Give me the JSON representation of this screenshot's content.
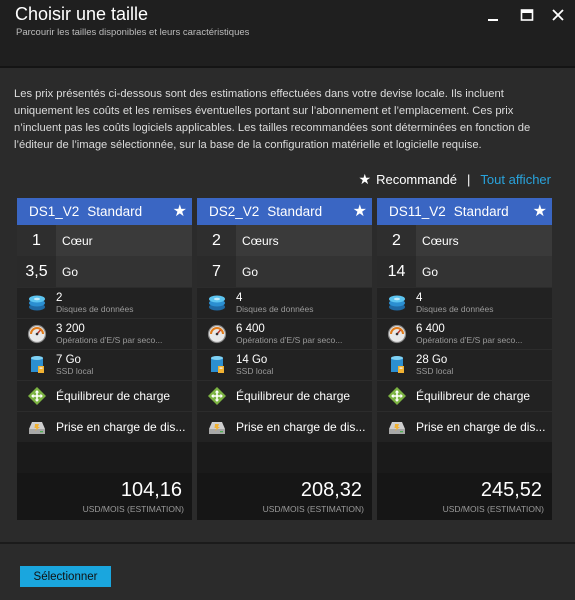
{
  "header": {
    "title": "Choisir une taille",
    "subtitle": "Parcourir les tailles disponibles et leurs caractéristiques"
  },
  "description": "Les prix présentés ci-dessous sont des estimations effectuées dans votre devise locale. Ils incluent uniquement les coûts et les remises éventuelles portant sur l’abonnement et l’emplacement. Ces prix n’incluent pas les coûts logiciels applicables. Les tailles recommandées sont déterminées en fonction de l’éditeur de l’image sélectionnée, sur la base de la configuration matérielle et logicielle requise.",
  "legend": {
    "recommended": "Recommandé",
    "separator": "|",
    "show_all": "Tout afficher"
  },
  "cards": [
    {
      "name": "DS1_V2",
      "tier": "Standard",
      "cores": "1",
      "cores_label": "Cœur",
      "memory": "3,5",
      "memory_label": "Go",
      "disks": "2",
      "disks_label": "Disques de données",
      "iops": "3 200",
      "iops_label": "Opérations d’E/S par seco...",
      "ssd": "7 Go",
      "ssd_label": "SSD local",
      "lb": "Équilibreur de charge",
      "disk_support": "Prise en charge de dis...",
      "price": "104,16",
      "price_label": "USD/MOIS (ESTIMATION)"
    },
    {
      "name": "DS2_V2",
      "tier": "Standard",
      "cores": "2",
      "cores_label": "Cœurs",
      "memory": "7",
      "memory_label": "Go",
      "disks": "4",
      "disks_label": "Disques de données",
      "iops": "6 400",
      "iops_label": "Opérations d’E/S par seco...",
      "ssd": "14 Go",
      "ssd_label": "SSD local",
      "lb": "Équilibreur de charge",
      "disk_support": "Prise en charge de dis...",
      "price": "208,32",
      "price_label": "USD/MOIS (ESTIMATION)"
    },
    {
      "name": "DS11_V2",
      "tier": "Standard",
      "cores": "2",
      "cores_label": "Cœurs",
      "memory": "14",
      "memory_label": "Go",
      "disks": "4",
      "disks_label": "Disques de données",
      "iops": "6 400",
      "iops_label": "Opérations d’E/S par seco...",
      "ssd": "28 Go",
      "ssd_label": "SSD local",
      "lb": "Équilibreur de charge",
      "disk_support": "Prise en charge de dis...",
      "price": "245,52",
      "price_label": "USD/MOIS (ESTIMATION)"
    }
  ],
  "footer": {
    "select_label": "Sélectionner"
  },
  "colors": {
    "accent_blue": "#3a66c3",
    "link_blue": "#29a3dc",
    "button_blue": "#1aa6de",
    "background": "#2b2b2b"
  },
  "icons": {
    "disks": "stacked-disks-icon",
    "iops": "gauge-icon",
    "ssd": "ssd-icon",
    "lb": "load-balancer-icon",
    "disk_support": "hard-drive-icon",
    "recommended": "star-icon"
  }
}
